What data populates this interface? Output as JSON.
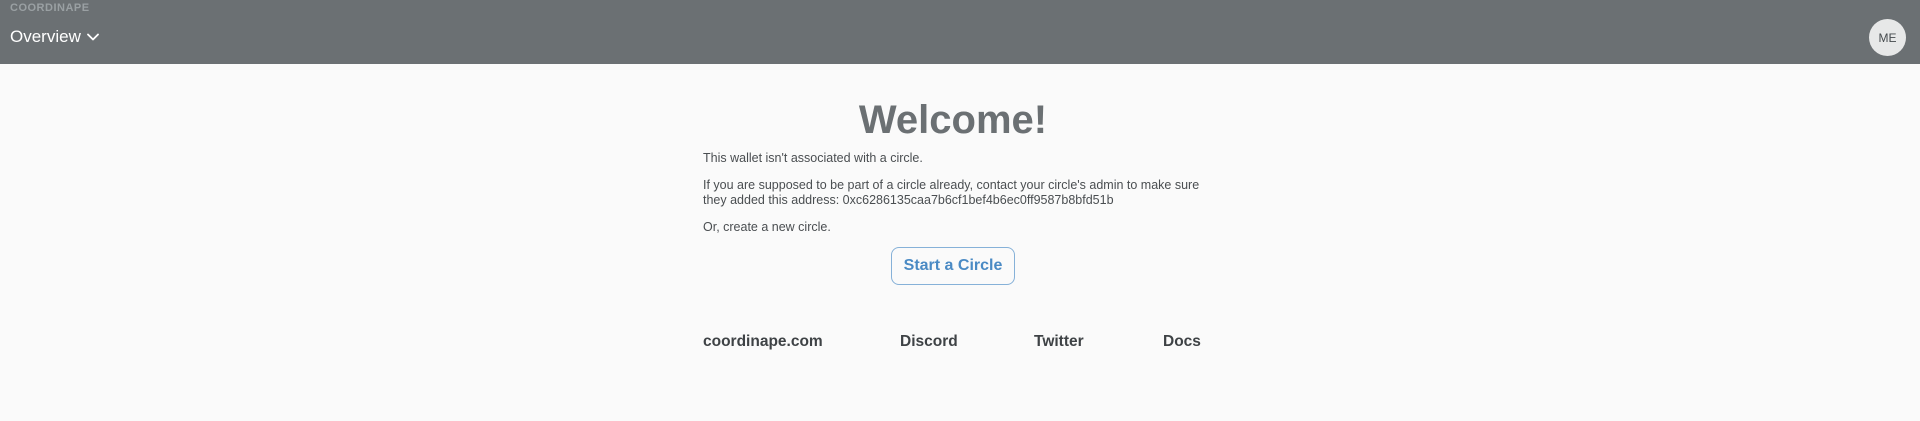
{
  "header": {
    "brand": "COORDINAPE",
    "menu_label": "Overview",
    "menu_icon": "chevron-down-icon",
    "avatar_initials": "ME"
  },
  "main": {
    "title": "Welcome!",
    "line1": "This wallet isn't associated with a circle.",
    "line2": "If you are supposed to be part of a circle already, contact your circle's admin to make sure they added this address: 0xc6286135caa7b6cf1bef4b6ec0ff9587b8bfd51b",
    "line3": "Or, create a new circle.",
    "button_label": "Start a Circle"
  },
  "footer_links": {
    "website": "coordinape.com",
    "discord": "Discord",
    "twitter": "Twitter",
    "docs": "Docs"
  },
  "colors": {
    "topbar": "#6b7073",
    "page_background": "#fafafa",
    "accent": "#4a8ac4"
  }
}
